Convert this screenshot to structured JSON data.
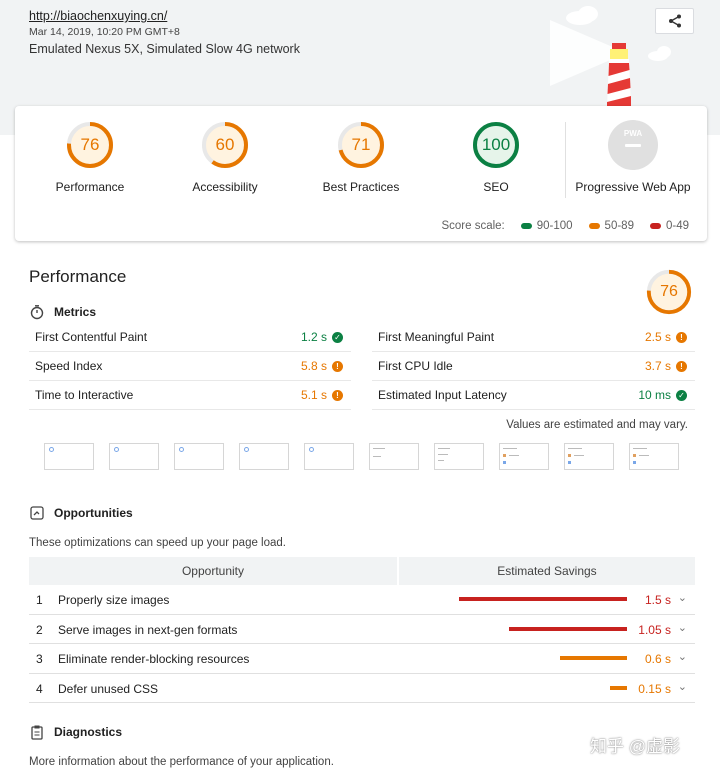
{
  "header": {
    "url": "http://biaochenxuying.cn/",
    "date": "Mar 14, 2019, 10:20 PM GMT+8",
    "environment": "Emulated Nexus 5X, Simulated Slow 4G network"
  },
  "colors": {
    "good": "#0b8043",
    "average": "#e67700",
    "fail": "#c7221f",
    "pwa": "#e0e0e0"
  },
  "scores": [
    {
      "value": "76",
      "label": "Performance",
      "rating": "average"
    },
    {
      "value": "60",
      "label": "Accessibility",
      "rating": "average"
    },
    {
      "value": "71",
      "label": "Best Practices",
      "rating": "average"
    },
    {
      "value": "100",
      "label": "SEO",
      "rating": "good"
    }
  ],
  "pwa": {
    "badge": "PWA",
    "label": "Progressive Web App"
  },
  "score_scale": {
    "label": "Score scale:",
    "ranges": [
      {
        "text": "90-100",
        "rating": "good"
      },
      {
        "text": "50-89",
        "rating": "average"
      },
      {
        "text": "0-49",
        "rating": "fail"
      }
    ]
  },
  "performance": {
    "title": "Performance",
    "score": "76",
    "metrics_title": "Metrics",
    "metrics_left": [
      {
        "name": "First Contentful Paint",
        "value": "1.2 s",
        "rating": "good"
      },
      {
        "name": "Speed Index",
        "value": "5.8 s",
        "rating": "average"
      },
      {
        "name": "Time to Interactive",
        "value": "5.1 s",
        "rating": "average"
      }
    ],
    "metrics_right": [
      {
        "name": "First Meaningful Paint",
        "value": "2.5 s",
        "rating": "average"
      },
      {
        "name": "First CPU Idle",
        "value": "3.7 s",
        "rating": "average"
      },
      {
        "name": "Estimated Input Latency",
        "value": "10 ms",
        "rating": "good"
      }
    ],
    "estimate_note": "Values are estimated and may vary.",
    "filmstrip_frames": 10
  },
  "opportunities": {
    "title": "Opportunities",
    "description": "These optimizations can speed up your page load.",
    "col_opportunity": "Opportunity",
    "col_savings": "Estimated Savings",
    "items": [
      {
        "index": "1",
        "title": "Properly size images",
        "savings": "1.5 s",
        "rating": "fail",
        "fraction": 1.0
      },
      {
        "index": "2",
        "title": "Serve images in next-gen formats",
        "savings": "1.05 s",
        "rating": "fail",
        "fraction": 0.7
      },
      {
        "index": "3",
        "title": "Eliminate render-blocking resources",
        "savings": "0.6 s",
        "rating": "average",
        "fraction": 0.4
      },
      {
        "index": "4",
        "title": "Defer unused CSS",
        "savings": "0.15 s",
        "rating": "average",
        "fraction": 0.1
      }
    ]
  },
  "diagnostics": {
    "title": "Diagnostics",
    "description": "More information about the performance of your application."
  },
  "watermark": "知乎 @虚影"
}
